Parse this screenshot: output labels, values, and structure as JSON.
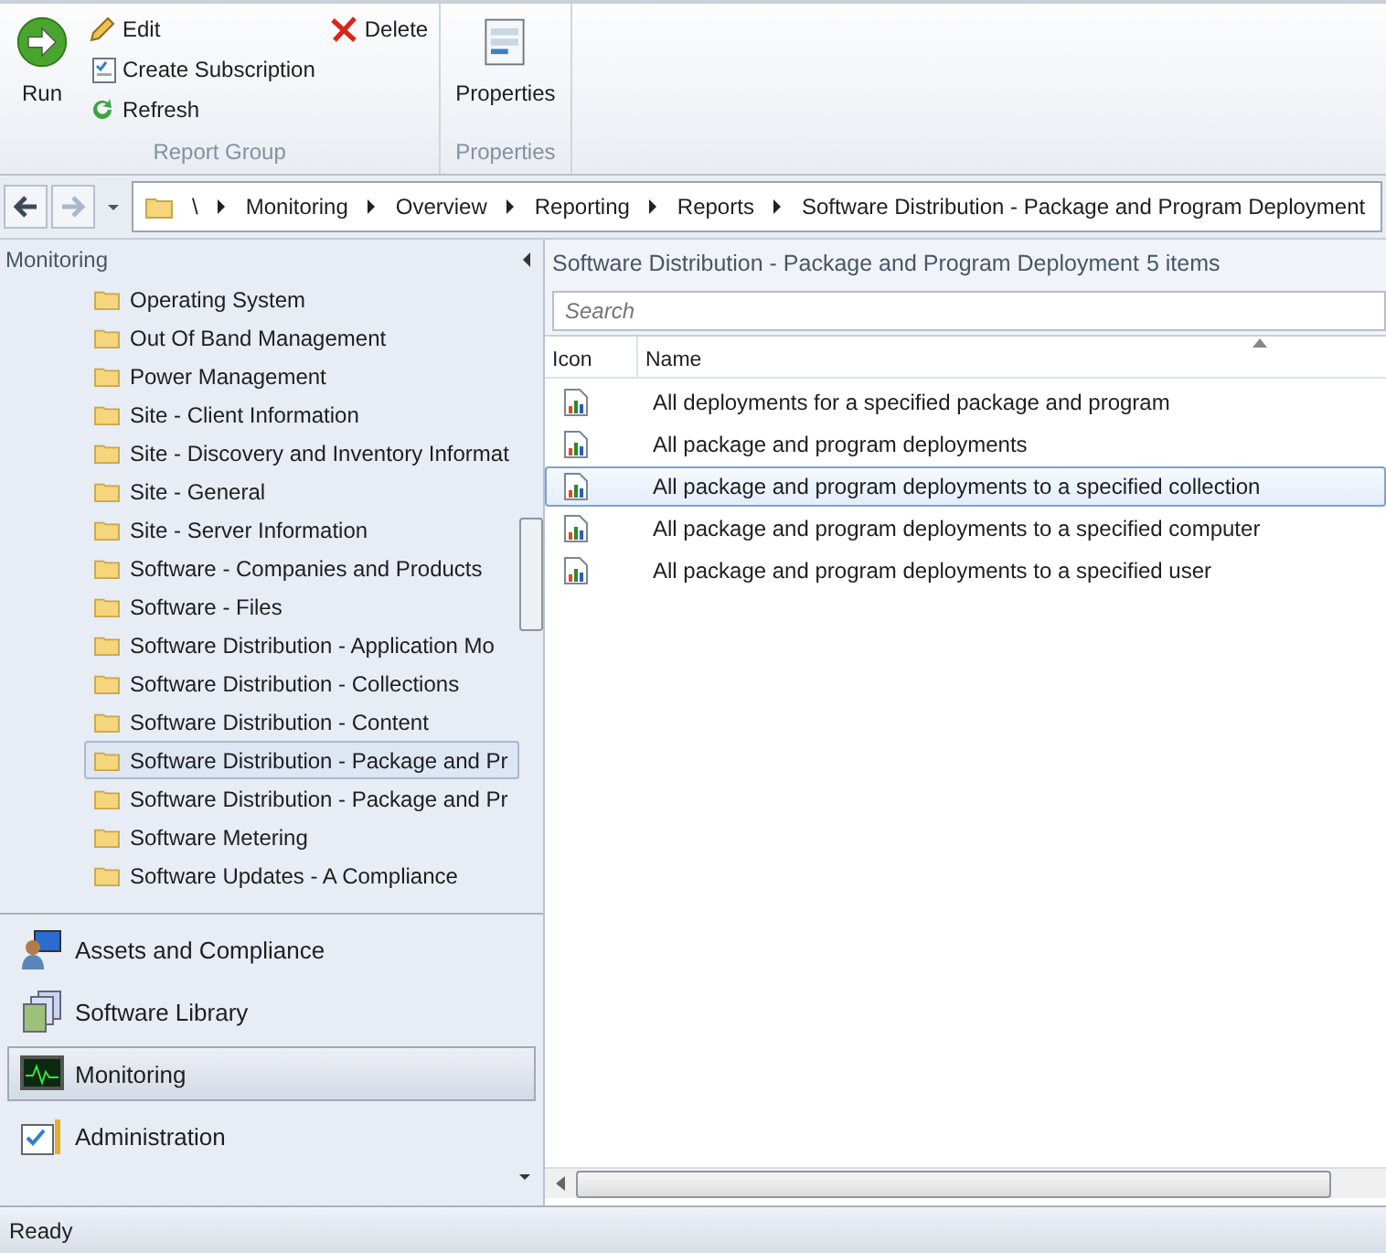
{
  "ribbon": {
    "groups": [
      {
        "label": "Report Group",
        "buttons": [
          {
            "kind": "run",
            "label": "Run"
          },
          {
            "kind": "edit",
            "label": "Edit"
          },
          {
            "kind": "subscription",
            "label": "Create Subscription"
          },
          {
            "kind": "refresh",
            "label": "Refresh"
          },
          {
            "kind": "delete",
            "label": "Delete"
          }
        ]
      },
      {
        "label": "Properties",
        "buttons": [
          {
            "kind": "properties",
            "label": "Properties"
          }
        ]
      }
    ]
  },
  "breadcrumb": [
    "\\",
    "Monitoring",
    "Overview",
    "Reporting",
    "Reports",
    "Software Distribution - Package and Program Deployment"
  ],
  "navigation_pane": {
    "title": "Monitoring",
    "tree_items": [
      {
        "label": "Operating System",
        "selected": false
      },
      {
        "label": "Out Of Band Management",
        "selected": false
      },
      {
        "label": "Power Management",
        "selected": false
      },
      {
        "label": "Site - Client Information",
        "selected": false
      },
      {
        "label": "Site - Discovery and Inventory Informat",
        "selected": false
      },
      {
        "label": "Site - General",
        "selected": false
      },
      {
        "label": "Site - Server Information",
        "selected": false
      },
      {
        "label": "Software - Companies and Products",
        "selected": false
      },
      {
        "label": "Software - Files",
        "selected": false
      },
      {
        "label": "Software Distribution - Application Mo",
        "selected": false
      },
      {
        "label": "Software Distribution - Collections",
        "selected": false
      },
      {
        "label": "Software Distribution - Content",
        "selected": false
      },
      {
        "label": "Software Distribution - Package and Pr",
        "selected": true
      },
      {
        "label": "Software Distribution - Package and Pr",
        "selected": false
      },
      {
        "label": "Software Metering",
        "selected": false
      },
      {
        "label": "Software Updates - A Compliance",
        "selected": false
      }
    ],
    "workspaces": [
      {
        "kind": "assets",
        "label": "Assets and Compliance",
        "selected": false
      },
      {
        "kind": "library",
        "label": "Software Library",
        "selected": false
      },
      {
        "kind": "monitoring",
        "label": "Monitoring",
        "selected": true
      },
      {
        "kind": "administration",
        "label": "Administration",
        "selected": false
      }
    ]
  },
  "content": {
    "title": "Software Distribution - Package and Program Deployment",
    "count": "5 items",
    "search": {
      "placeholder": "Search"
    },
    "columns": [
      "Icon",
      "Name"
    ],
    "rows": [
      {
        "name": "All deployments for a specified package and program",
        "selected": false
      },
      {
        "name": "All package and program deployments",
        "selected": false
      },
      {
        "name": "All package and program deployments to a specified collection",
        "selected": true
      },
      {
        "name": "All package and program deployments to a specified computer",
        "selected": false
      },
      {
        "name": "All package and program deployments to a specified user",
        "selected": false
      }
    ]
  },
  "status_bar": "Ready"
}
